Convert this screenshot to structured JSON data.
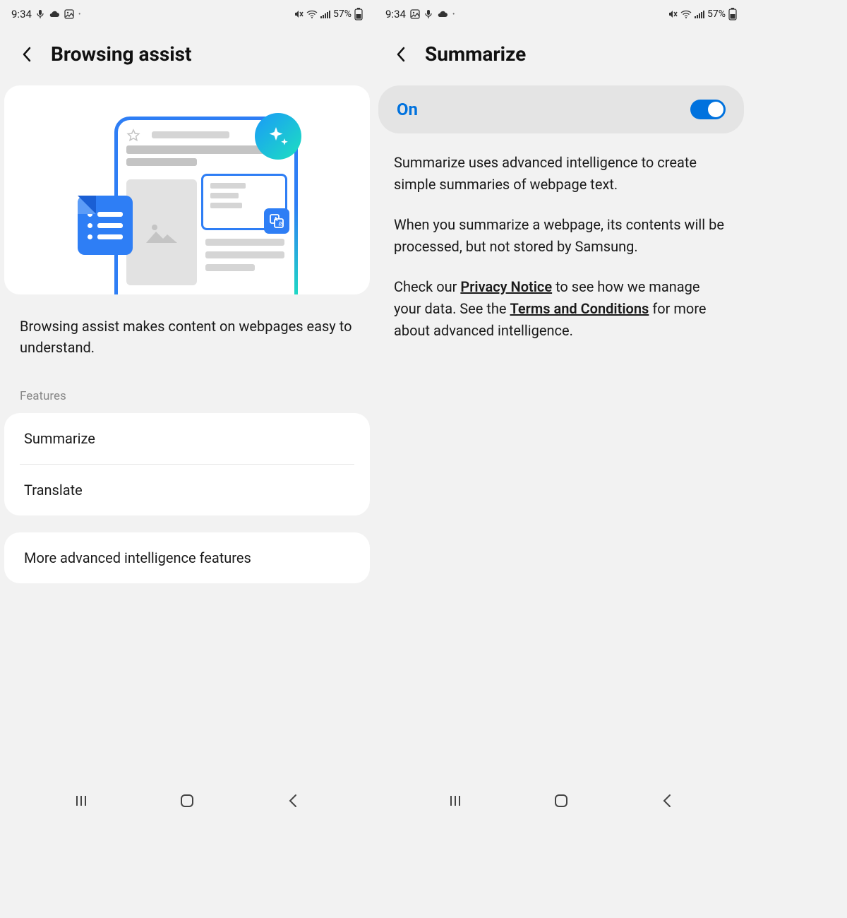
{
  "status": {
    "time": "9:34",
    "battery_pct": "57%"
  },
  "left": {
    "title": "Browsing assist",
    "description": "Browsing assist makes content on webpages easy to understand.",
    "features_label": "Features",
    "features": {
      "summarize": "Summarize",
      "translate": "Translate"
    },
    "more": "More advanced intelligence features"
  },
  "right": {
    "title": "Summarize",
    "toggle_label": "On",
    "toggle_state": true,
    "para1": "Summarize uses advanced intelligence to create simple summaries of webpage text.",
    "para2": "When you summarize a webpage, its contents will be processed, but not stored by Samsung.",
    "para3_pre": "Check our ",
    "privacy_link": "Privacy Notice",
    "para3_mid": " to see how we manage your data. See the ",
    "terms_link": "Terms and Conditions",
    "para3_post": " for more about advanced intelligence."
  }
}
